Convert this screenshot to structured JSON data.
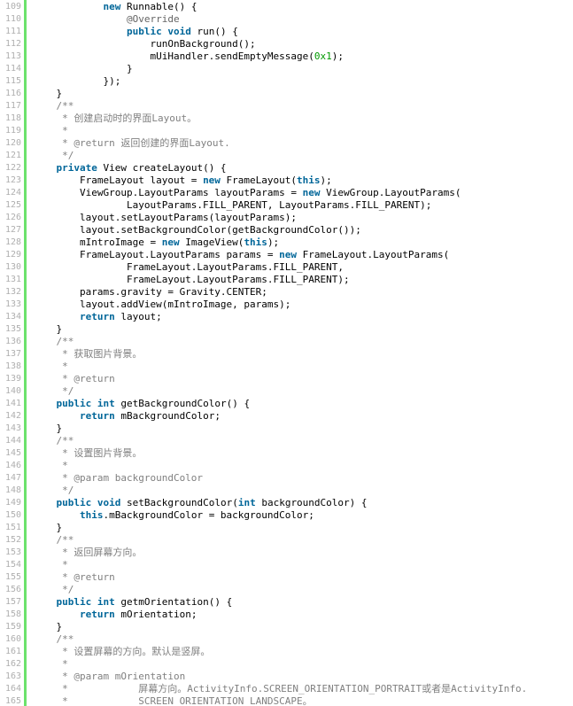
{
  "colors": {
    "keyword": "#006699",
    "comment": "#808080",
    "annotation": "#646464",
    "number": "#009900",
    "text": "#000000",
    "line_number": "#afafaf",
    "gutter_bar": "#6ce26c"
  },
  "code": {
    "lines": [
      {
        "no": "109",
        "tokens": [
          [
            "tx",
            "            "
          ],
          [
            "kw",
            "new"
          ],
          [
            "tx",
            " Runnable() {"
          ]
        ]
      },
      {
        "no": "110",
        "tokens": [
          [
            "tx",
            "                "
          ],
          [
            "an",
            "@Override"
          ]
        ]
      },
      {
        "no": "111",
        "tokens": [
          [
            "tx",
            "                "
          ],
          [
            "kw",
            "public"
          ],
          [
            "tx",
            " "
          ],
          [
            "kw",
            "void"
          ],
          [
            "tx",
            " run() {"
          ]
        ]
      },
      {
        "no": "112",
        "tokens": [
          [
            "tx",
            "                    runOnBackground();"
          ]
        ]
      },
      {
        "no": "113",
        "tokens": [
          [
            "tx",
            "                    mUiHandler.sendEmptyMessage("
          ],
          [
            "nm",
            "0x1"
          ],
          [
            "tx",
            ");"
          ]
        ]
      },
      {
        "no": "114",
        "tokens": [
          [
            "tx",
            "                }"
          ]
        ]
      },
      {
        "no": "115",
        "tokens": [
          [
            "tx",
            "            });"
          ]
        ]
      },
      {
        "no": "116",
        "tokens": [
          [
            "tx",
            "    }"
          ]
        ]
      },
      {
        "no": "117",
        "tokens": [
          [
            "cm",
            "    /**"
          ]
        ]
      },
      {
        "no": "118",
        "tokens": [
          [
            "cm",
            "     * 创建启动时的界面Layout。"
          ]
        ]
      },
      {
        "no": "119",
        "tokens": [
          [
            "cm",
            "     *"
          ]
        ]
      },
      {
        "no": "120",
        "tokens": [
          [
            "cm",
            "     * @return 返回创建的界面Layout."
          ]
        ]
      },
      {
        "no": "121",
        "tokens": [
          [
            "cm",
            "     */"
          ]
        ]
      },
      {
        "no": "122",
        "tokens": [
          [
            "tx",
            "    "
          ],
          [
            "kw",
            "private"
          ],
          [
            "tx",
            " View createLayout() {"
          ]
        ]
      },
      {
        "no": "123",
        "tokens": [
          [
            "tx",
            "        FrameLayout layout = "
          ],
          [
            "kw",
            "new"
          ],
          [
            "tx",
            " FrameLayout("
          ],
          [
            "kw",
            "this"
          ],
          [
            "tx",
            ");"
          ]
        ]
      },
      {
        "no": "124",
        "tokens": [
          [
            "tx",
            "        ViewGroup.LayoutParams layoutParams = "
          ],
          [
            "kw",
            "new"
          ],
          [
            "tx",
            " ViewGroup.LayoutParams("
          ]
        ]
      },
      {
        "no": "125",
        "tokens": [
          [
            "tx",
            "                LayoutParams.FILL_PARENT, LayoutParams.FILL_PARENT);"
          ]
        ]
      },
      {
        "no": "126",
        "tokens": [
          [
            "tx",
            "        layout.setLayoutParams(layoutParams);"
          ]
        ]
      },
      {
        "no": "127",
        "tokens": [
          [
            "tx",
            "        layout.setBackgroundColor(getBackgroundColor());"
          ]
        ]
      },
      {
        "no": "128",
        "tokens": [
          [
            "tx",
            "        mIntroImage = "
          ],
          [
            "kw",
            "new"
          ],
          [
            "tx",
            " ImageView("
          ],
          [
            "kw",
            "this"
          ],
          [
            "tx",
            ");"
          ]
        ]
      },
      {
        "no": "129",
        "tokens": [
          [
            "tx",
            "        FrameLayout.LayoutParams params = "
          ],
          [
            "kw",
            "new"
          ],
          [
            "tx",
            " FrameLayout.LayoutParams("
          ]
        ]
      },
      {
        "no": "130",
        "tokens": [
          [
            "tx",
            "                FrameLayout.LayoutParams.FILL_PARENT,"
          ]
        ]
      },
      {
        "no": "131",
        "tokens": [
          [
            "tx",
            "                FrameLayout.LayoutParams.FILL_PARENT);"
          ]
        ]
      },
      {
        "no": "132",
        "tokens": [
          [
            "tx",
            "        params.gravity = Gravity.CENTER;"
          ]
        ]
      },
      {
        "no": "133",
        "tokens": [
          [
            "tx",
            "        layout.addView(mIntroImage, params);"
          ]
        ]
      },
      {
        "no": "134",
        "tokens": [
          [
            "tx",
            "        "
          ],
          [
            "kw",
            "return"
          ],
          [
            "tx",
            " layout;"
          ]
        ]
      },
      {
        "no": "135",
        "tokens": [
          [
            "tx",
            "    }"
          ]
        ]
      },
      {
        "no": "136",
        "tokens": [
          [
            "cm",
            "    /**"
          ]
        ]
      },
      {
        "no": "137",
        "tokens": [
          [
            "cm",
            "     * 获取图片背景。"
          ]
        ]
      },
      {
        "no": "138",
        "tokens": [
          [
            "cm",
            "     *"
          ]
        ]
      },
      {
        "no": "139",
        "tokens": [
          [
            "cm",
            "     * @return"
          ]
        ]
      },
      {
        "no": "140",
        "tokens": [
          [
            "cm",
            "     */"
          ]
        ]
      },
      {
        "no": "141",
        "tokens": [
          [
            "tx",
            "    "
          ],
          [
            "kw",
            "public"
          ],
          [
            "tx",
            " "
          ],
          [
            "kw",
            "int"
          ],
          [
            "tx",
            " getBackgroundColor() {"
          ]
        ]
      },
      {
        "no": "142",
        "tokens": [
          [
            "tx",
            "        "
          ],
          [
            "kw",
            "return"
          ],
          [
            "tx",
            " mBackgroundColor;"
          ]
        ]
      },
      {
        "no": "143",
        "tokens": [
          [
            "tx",
            "    }"
          ]
        ]
      },
      {
        "no": "144",
        "tokens": [
          [
            "cm",
            "    /**"
          ]
        ]
      },
      {
        "no": "145",
        "tokens": [
          [
            "cm",
            "     * 设置图片背景。"
          ]
        ]
      },
      {
        "no": "146",
        "tokens": [
          [
            "cm",
            "     *"
          ]
        ]
      },
      {
        "no": "147",
        "tokens": [
          [
            "cm",
            "     * @param backgroundColor"
          ]
        ]
      },
      {
        "no": "148",
        "tokens": [
          [
            "cm",
            "     */"
          ]
        ]
      },
      {
        "no": "149",
        "tokens": [
          [
            "tx",
            "    "
          ],
          [
            "kw",
            "public"
          ],
          [
            "tx",
            " "
          ],
          [
            "kw",
            "void"
          ],
          [
            "tx",
            " setBackgroundColor("
          ],
          [
            "kw",
            "int"
          ],
          [
            "tx",
            " backgroundColor) {"
          ]
        ]
      },
      {
        "no": "150",
        "tokens": [
          [
            "tx",
            "        "
          ],
          [
            "kw",
            "this"
          ],
          [
            "tx",
            ".mBackgroundColor = backgroundColor;"
          ]
        ]
      },
      {
        "no": "151",
        "tokens": [
          [
            "tx",
            "    }"
          ]
        ]
      },
      {
        "no": "152",
        "tokens": [
          [
            "cm",
            "    /**"
          ]
        ]
      },
      {
        "no": "153",
        "tokens": [
          [
            "cm",
            "     * 返回屏幕方向。"
          ]
        ]
      },
      {
        "no": "154",
        "tokens": [
          [
            "cm",
            "     *"
          ]
        ]
      },
      {
        "no": "155",
        "tokens": [
          [
            "cm",
            "     * @return"
          ]
        ]
      },
      {
        "no": "156",
        "tokens": [
          [
            "cm",
            "     */"
          ]
        ]
      },
      {
        "no": "157",
        "tokens": [
          [
            "tx",
            "    "
          ],
          [
            "kw",
            "public"
          ],
          [
            "tx",
            " "
          ],
          [
            "kw",
            "int"
          ],
          [
            "tx",
            " getmOrientation() {"
          ]
        ]
      },
      {
        "no": "158",
        "tokens": [
          [
            "tx",
            "        "
          ],
          [
            "kw",
            "return"
          ],
          [
            "tx",
            " mOrientation;"
          ]
        ]
      },
      {
        "no": "159",
        "tokens": [
          [
            "tx",
            "    }"
          ]
        ]
      },
      {
        "no": "160",
        "tokens": [
          [
            "cm",
            "    /**"
          ]
        ]
      },
      {
        "no": "161",
        "tokens": [
          [
            "cm",
            "     * 设置屏幕的方向。默认是竖屏。"
          ]
        ]
      },
      {
        "no": "162",
        "tokens": [
          [
            "cm",
            "     *"
          ]
        ]
      },
      {
        "no": "163",
        "tokens": [
          [
            "cm",
            "     * @param mOrientation"
          ]
        ]
      },
      {
        "no": "164",
        "tokens": [
          [
            "cm",
            "     *            屏幕方向。ActivityInfo.SCREEN_ORIENTATION_PORTRAIT或者是ActivityInfo."
          ]
        ]
      },
      {
        "no": "165",
        "tokens": [
          [
            "cm",
            "     *            SCREEN_ORIENTATION_LANDSCAPE。"
          ]
        ]
      }
    ]
  }
}
